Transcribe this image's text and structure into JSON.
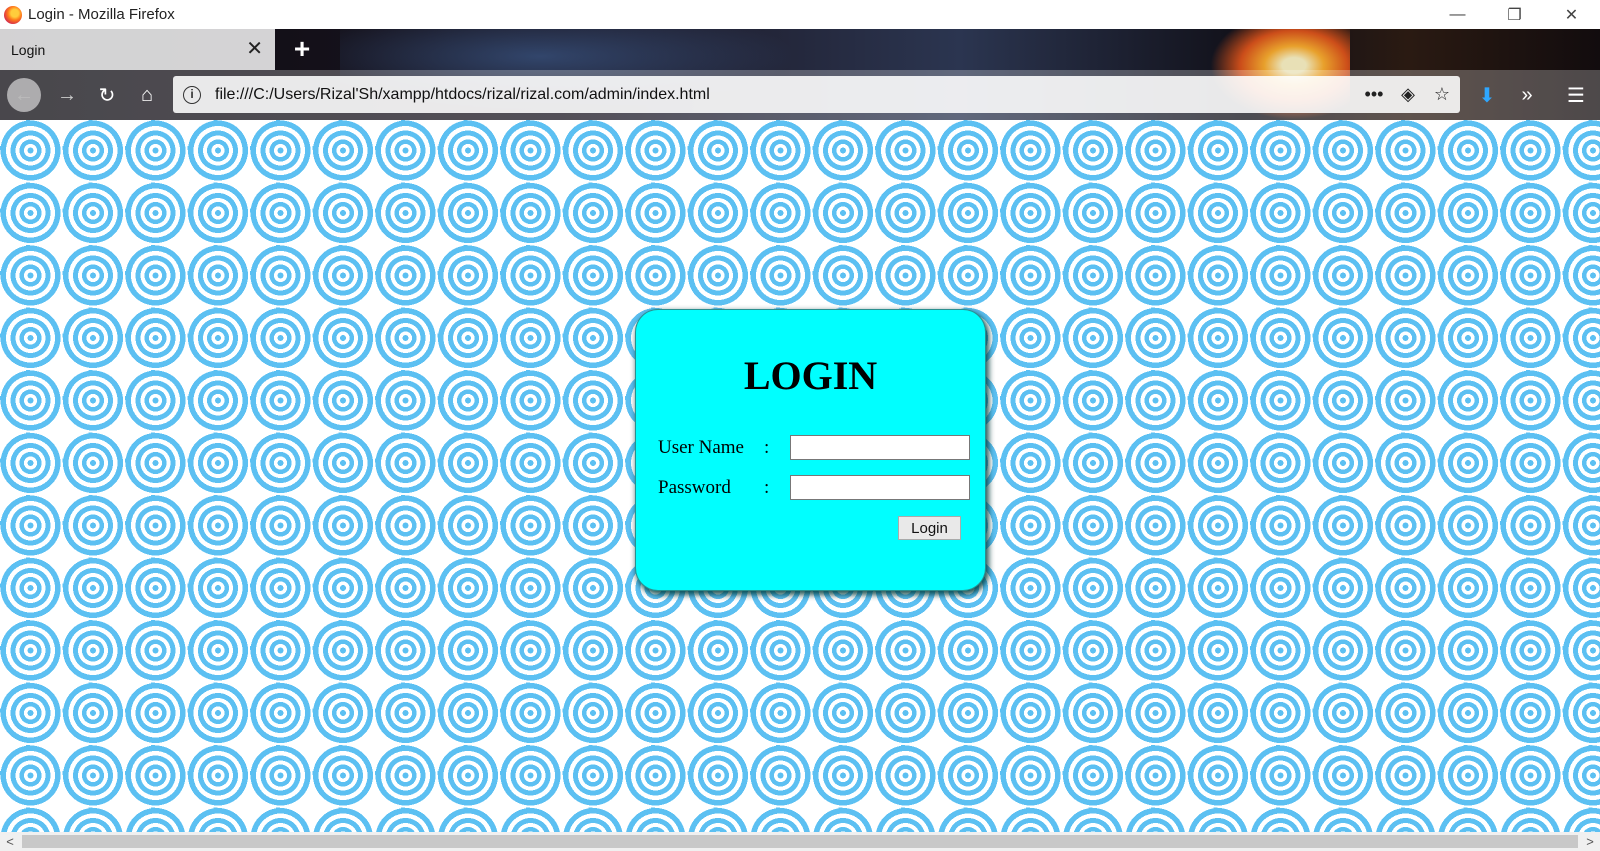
{
  "window": {
    "title": "Login - Mozilla Firefox",
    "controls": {
      "minimize": "—",
      "restore": "❐",
      "close": "✕"
    }
  },
  "tabs": [
    {
      "label": "Login",
      "close": "✕"
    }
  ],
  "new_tab_symbol": "+",
  "navbar": {
    "back": "←",
    "forward": "→",
    "reload": "↻",
    "home": "⌂",
    "info": "i",
    "url": "file:///C:/Users/Rizal'Sh/xampp/htdocs/rizal/rizal.com/admin/index.html",
    "page_actions": "•••",
    "pocket": "◈",
    "bookmark": "☆",
    "download": "⬇",
    "overflow": "»",
    "menu": "☰"
  },
  "login_form": {
    "heading": "LOGIN",
    "username_label": "User Name",
    "password_label": "Password",
    "separator": ":",
    "username_value": "",
    "password_value": "",
    "submit_label": "Login"
  },
  "scrollbar": {
    "left": "<",
    "right": ">"
  },
  "colors": {
    "form_background": "#00ffff",
    "page_pattern": "#5cc0f2",
    "download_icon": "#2ea7ff"
  }
}
